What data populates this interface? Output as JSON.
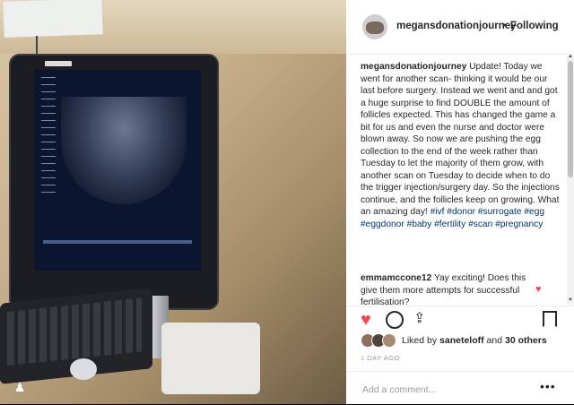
{
  "header": {
    "username": "megansdonationjourney",
    "separator": "•",
    "follow_label": "Following"
  },
  "caption": {
    "username": "megansdonationjourney",
    "text": "Update! Today we went for another scan- thinking it would be our last before surgery. Instead we went and and got a huge surprise to find DOUBLE the amount of follicles expected. This has changed the game a bit for us and even the nurse and doctor were blown away. So now we are pushing the egg collection to the end of the week rather than Tuesday to let the majority of them grow, with another scan on Tuesday to decide when to do the trigger injection/surgery day. So the injections continue, and the follicles keep on growing. What an amazing day!",
    "tags": "#ivf #donor #surrogate #egg #eggdonor #baby #fertility #scan #pregnancy"
  },
  "comment": {
    "username": "emmamccone12",
    "text": "Yay exciting! Does this give them more attempts for successful fertilisation?"
  },
  "likes": {
    "prefix": "Liked by",
    "user": "saneteloff",
    "and": "and",
    "others": "30 others"
  },
  "date": "1 DAY AGO",
  "add_comment": {
    "placeholder": "Add a comment..."
  },
  "icons": {
    "heart": "heart-icon",
    "comment": "comment-icon",
    "share": "share-icon",
    "bookmark": "bookmark-icon",
    "more": "more-options-icon",
    "user": "user-icon"
  },
  "colors": {
    "like_red": "#ed4956",
    "tag_blue": "#003569",
    "text": "#262626",
    "muted": "#999999"
  }
}
